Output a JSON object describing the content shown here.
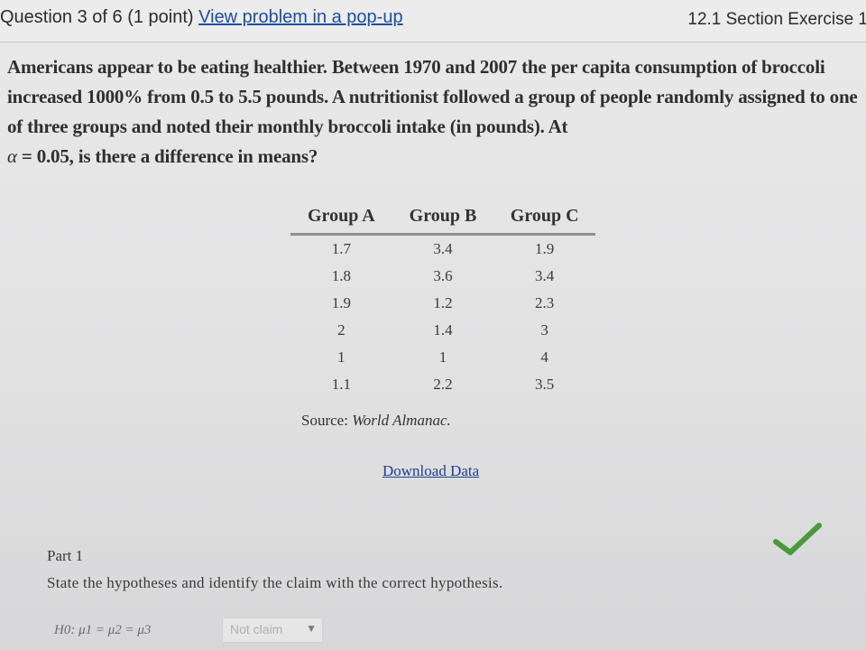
{
  "header": {
    "question_progress": "Question 3 of 6 (1 point)",
    "popup_link": "View problem in a pop-up",
    "section_label": "12.1 Section Exercise 1"
  },
  "problem": {
    "text_before_alpha": "Americans appear to be eating healthier. Between 1970 and 2007 the per capita consumption of broccoli increased 1000% from 0.5 to 5.5 pounds. A nutritionist followed a group of people randomly assigned to one of three groups and noted their monthly broccoli intake (in pounds). At",
    "alpha_symbol": "α",
    "text_after_alpha": " = 0.05, is there a difference in means?"
  },
  "table": {
    "headers": [
      "Group A",
      "Group B",
      "Group C"
    ],
    "rows": [
      [
        "1.7",
        "3.4",
        "1.9"
      ],
      [
        "1.8",
        "3.6",
        "3.4"
      ],
      [
        "1.9",
        "1.2",
        "2.3"
      ],
      [
        "2",
        "1.4",
        "3"
      ],
      [
        "1",
        "1",
        "4"
      ],
      [
        "1.1",
        "2.2",
        "3.5"
      ]
    ],
    "source_prefix": "Source: ",
    "source_title": "World Almanac."
  },
  "download_link": "Download Data",
  "part": {
    "title": "Part 1",
    "instruction": "State the hypotheses and identify the claim with the correct hypothesis."
  },
  "hypothesis": {
    "text": "H0: μ1 = μ2 = μ3",
    "claim_value": "Not claim"
  },
  "colors": {
    "link": "#1c4fa0",
    "check": "#4a9a3c"
  }
}
